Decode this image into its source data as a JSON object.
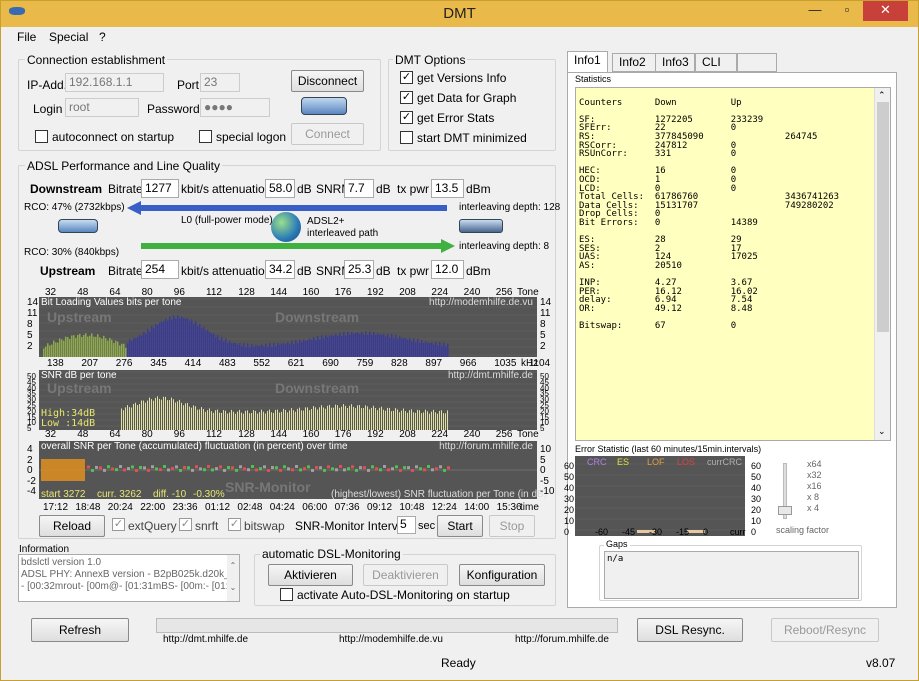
{
  "window": {
    "title": "DMT",
    "version": "v8.07"
  },
  "menu": [
    "File",
    "Special",
    "?"
  ],
  "conn": {
    "title": "Connection establishment",
    "ip_label": "IP-Add.",
    "ip": "192.168.1.1",
    "port_label": "Port",
    "port": "23",
    "login_label": "Login",
    "login": "root",
    "pw_label": "Password",
    "pw": "●●●●",
    "disconnect": "Disconnect",
    "connect": "Connect",
    "autoconnect": "autoconnect on startup",
    "speciallogon": "special logon"
  },
  "options": {
    "title": "DMT Options",
    "items": [
      {
        "label": "get Versions Info",
        "checked": true
      },
      {
        "label": "get Data for Graph",
        "checked": true
      },
      {
        "label": "get Error Stats",
        "checked": true
      },
      {
        "label": "start DMT minimized",
        "checked": false
      }
    ]
  },
  "adsl": {
    "title": "ADSL Performance and Line Quality",
    "down": {
      "label": "Downstream",
      "bitrate_label": "Bitrate",
      "bitrate": "1277",
      "bitrate_unit": "kbit/s",
      "att_label": "attenuation",
      "att": "58.0",
      "att_unit": "dB",
      "snrm_label": "SNRM",
      "snrm": "7.7",
      "snrm_unit": "dB",
      "txpwr_label": "tx pwr",
      "txpwr": "13.5",
      "txpwr_unit": "dBm",
      "rco": "RCO: 47% (2732kbps)",
      "interleave": "interleaving depth: 128"
    },
    "up": {
      "label": "Upstream",
      "bitrate_label": "Bitrate",
      "bitrate": "254",
      "bitrate_unit": "kbit/s",
      "att_label": "attenuation",
      "att": "34.2",
      "att_unit": "dB",
      "snrm_label": "SNRM",
      "snrm": "25.3",
      "snrm_unit": "dB",
      "txpwr_label": "tx pwr",
      "txpwr": "12.0",
      "txpwr_unit": "dBm",
      "rco": "RCO: 30% (840kbps)",
      "interleave": "interleaving depth: 8"
    },
    "mode": "L0 (full-power mode)",
    "standard": "ADSL2+",
    "path": "interleaved path"
  },
  "graphs": {
    "tones": [
      "32",
      "48",
      "64",
      "80",
      "96",
      "112",
      "128",
      "144",
      "160",
      "176",
      "192",
      "208",
      "224",
      "240",
      "256"
    ],
    "tone_label": "Tone",
    "khz": [
      "138",
      "207",
      "276",
      "345",
      "414",
      "483",
      "552",
      "621",
      "690",
      "759",
      "828",
      "897",
      "966",
      "1035",
      "1104"
    ],
    "khz_label": "kHz",
    "bits": {
      "title": "Bit Loading Values   bits per tone",
      "url": "http://modemhilfe.de.vu",
      "up": "Upstream",
      "down": "Downstream",
      "yticks": [
        "14",
        "11",
        "8",
        "5",
        "2"
      ]
    },
    "snr": {
      "title": "SNR  dB per tone",
      "url": "http://dmt.mhilfe.de",
      "up": "Upstream",
      "down": "Downstream",
      "high": "High:34dB",
      "low": "Low :14dB",
      "yticks": [
        "50",
        "45",
        "40",
        "35",
        "30",
        "25",
        "20",
        "15",
        "10",
        "5"
      ]
    },
    "mon": {
      "title": "overall SNR per Tone (accumulated) fluctuation (in percent) over time",
      "url": "http://forum.mhilfe.de",
      "watermark": "SNR-Monitor",
      "start": "start 3272",
      "curr": "curr. 3262",
      "diff": "diff. -10",
      "pct": "-0.30%",
      "footer": "(highest/lowest) SNR fluctuation per Tone (in dB)",
      "yl": [
        "4",
        "2",
        "0",
        "-2",
        "-4"
      ],
      "yr": [
        "10",
        "5",
        "0",
        "-5",
        "-10"
      ],
      "times": [
        "17:12",
        "18:48",
        "20:24",
        "22:00",
        "23:36",
        "01:12",
        "02:48",
        "04:24",
        "06:00",
        "07:36",
        "09:12",
        "10:48",
        "12:24",
        "14:00",
        "15:36"
      ],
      "time_label": "time"
    },
    "reload": "Reload",
    "extquery": "extQuery",
    "snrft": "snrft",
    "bitswap": "bitswap",
    "interval_label": "SNR-Monitor Interval:",
    "interval": "5",
    "interval_unit": "sec",
    "start_btn": "Start",
    "stop_btn": "Stop"
  },
  "information": {
    "title": "Information",
    "lines": [
      "bdslctl version 1.0",
      "ADSL PHY: AnnexB version - B2pB025k.d20k_r",
      "- [00:32mrout- [00m@- [01:31mBS- [00m:- [01:"
    ]
  },
  "auto": {
    "title": "automatic DSL-Monitoring",
    "activate": "Aktivieren",
    "deactivate": "Deaktivieren",
    "config": "Konfiguration",
    "startup": "activate Auto-DSL-Monitoring on startup"
  },
  "tabs": [
    "Info1",
    "Info2",
    "Info3",
    "CLI",
    ""
  ],
  "stats": {
    "title": "Statistics",
    "lines": [
      "",
      "Counters      Down          Up",
      "",
      "SF:           1272205       233239",
      "SFErr:        22            0",
      "RS:           377845090               264745",
      "RSCorr:       247812        0",
      "RSUnCorr:     331           0",
      "",
      "HEC:          16            0",
      "OCD:          1             0",
      "LCD:          0             0",
      "Total Cells:  61786760                3436741263",
      "Data Cells:   15131707                749280202",
      "Drop Cells:   0",
      "Bit Errors:   0             14389",
      "",
      "ES:           28            29",
      "SES:          2             17",
      "UAS:          124           17025",
      "AS:           20510",
      "",
      "INP:          4.27          3.67",
      "PER:          16.12         16.02",
      "delay:        6.94          7.54",
      "OR:           49.12         8.48",
      "",
      "Bitswap:      67            0"
    ]
  },
  "errstat": {
    "title": "Error Statistic (last 60 minutes/15min.intervals)",
    "legend": [
      {
        "label": "CRC",
        "color": "#b080e0"
      },
      {
        "label": "ES",
        "color": "#e0e040"
      },
      {
        "label": "LOF",
        "color": "#e0a040"
      },
      {
        "label": "LOS",
        "color": "#e04040"
      },
      {
        "label": "currCRC",
        "color": "#b0b0b0"
      }
    ],
    "yticks": [
      "60",
      "50",
      "40",
      "30",
      "20",
      "10",
      "0"
    ],
    "xticks": [
      "-60",
      "-45",
      "-30",
      "-15",
      "0",
      "curr"
    ],
    "scale": [
      "x64",
      "x32",
      "x16",
      "x 8",
      "x 4"
    ],
    "scale_label": "scaling factor",
    "bars": [
      {
        "x": "-45",
        "v": 1
      },
      {
        "x": "-15",
        "v": 1
      }
    ]
  },
  "gaps": {
    "title": "Gaps",
    "value": "n/a"
  },
  "bottom": {
    "refresh": "Refresh",
    "resync": "DSL Resync.",
    "reboot": "Reboot/Resync",
    "links": [
      "http://dmt.mhilfe.de",
      "http://modemhilfe.de.vu",
      "http://forum.mhilfe.de"
    ]
  },
  "status": "Ready",
  "colors": {
    "title": "#e9b949",
    "upstream": "#8ea84e",
    "downstream": "#3a3a9a",
    "snr": "#e0e0a0",
    "info": "#ffffc0"
  }
}
